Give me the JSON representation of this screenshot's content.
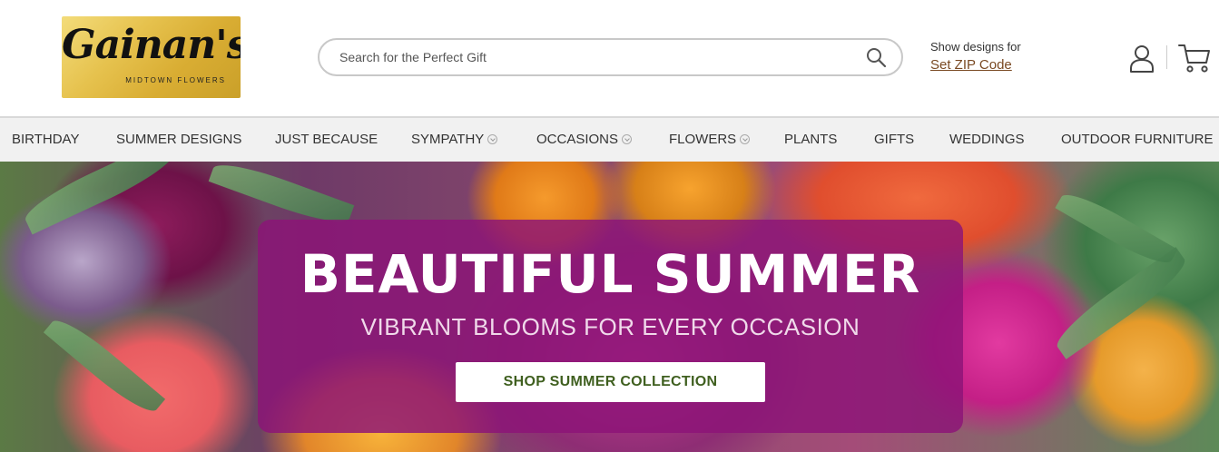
{
  "logo": {
    "script": "Gainan's",
    "tagline": "MIDTOWN FLOWERS"
  },
  "search": {
    "placeholder": "Search for the Perfect Gift",
    "icon": "search-icon"
  },
  "zip": {
    "label": "Show designs for",
    "link": "Set ZIP Code"
  },
  "header_icons": {
    "account": "user-icon",
    "cart": "cart-icon"
  },
  "nav": {
    "items": [
      {
        "label": "BIRTHDAY",
        "dropdown": false
      },
      {
        "label": "SUMMER DESIGNS",
        "dropdown": false
      },
      {
        "label": "JUST BECAUSE",
        "dropdown": false
      },
      {
        "label": "SYMPATHY",
        "dropdown": true
      },
      {
        "label": "OCCASIONS",
        "dropdown": true
      },
      {
        "label": "FLOWERS",
        "dropdown": true
      },
      {
        "label": "PLANTS",
        "dropdown": false
      },
      {
        "label": "GIFTS",
        "dropdown": false
      },
      {
        "label": "WEDDINGS",
        "dropdown": false
      },
      {
        "label": "OUTDOOR FURNITURE",
        "dropdown": false
      }
    ]
  },
  "hero": {
    "headline": "BEAUTIFUL SUMMER",
    "subline": "VIBRANT BLOOMS FOR EVERY OCCASION",
    "cta": "SHOP SUMMER COLLECTION"
  },
  "colors": {
    "overlay": "#8c1478",
    "cta_text": "#3f5f1f",
    "zip_link": "#7a4a23",
    "logo_gold": "#e6c24e"
  }
}
